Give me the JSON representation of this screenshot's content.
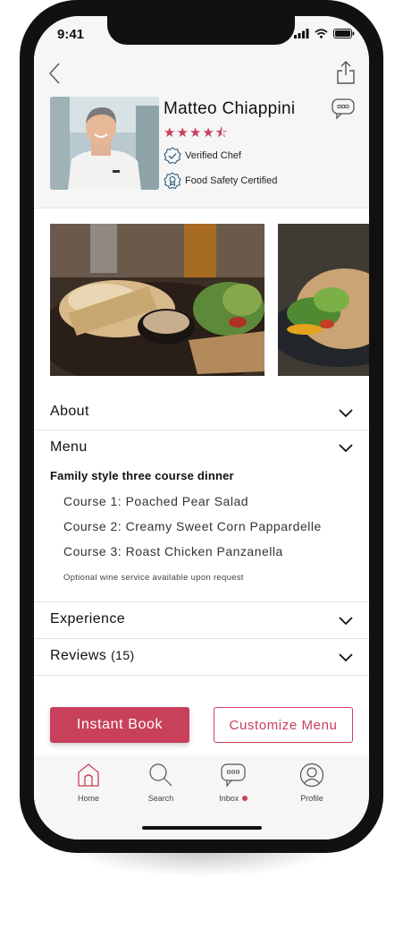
{
  "status": {
    "time": "9:41"
  },
  "chef": {
    "name": "Matteo Chiappini",
    "stars": "★★★★⯪",
    "rating": 4.5,
    "badges": [
      "Verified Chef",
      "Food Safety Certified"
    ]
  },
  "sections": {
    "about": "About",
    "menu": "Menu",
    "experience": "Experience",
    "reviews": "Reviews",
    "reviews_count": "(15)"
  },
  "menu": {
    "title": "Family style three course dinner",
    "courses": [
      "Course 1:  Poached Pear Salad",
      "Course 2:  Creamy Sweet Corn Pappardelle",
      "Course 3:  Roast Chicken Panzanella"
    ],
    "note": "Optional wine service available upon request"
  },
  "actions": {
    "instant_book": "Instant Book",
    "customize_menu": "Customize Menu"
  },
  "tabs": [
    {
      "label": "Home",
      "icon": "home-icon",
      "active": true
    },
    {
      "label": "Search",
      "icon": "search-icon"
    },
    {
      "label": "Inbox",
      "icon": "inbox-icon",
      "notification": true
    },
    {
      "label": "Profile",
      "icon": "profile-icon"
    }
  ],
  "colors": {
    "accent": "#c8405a",
    "header_bg": "#f6f6f6"
  }
}
